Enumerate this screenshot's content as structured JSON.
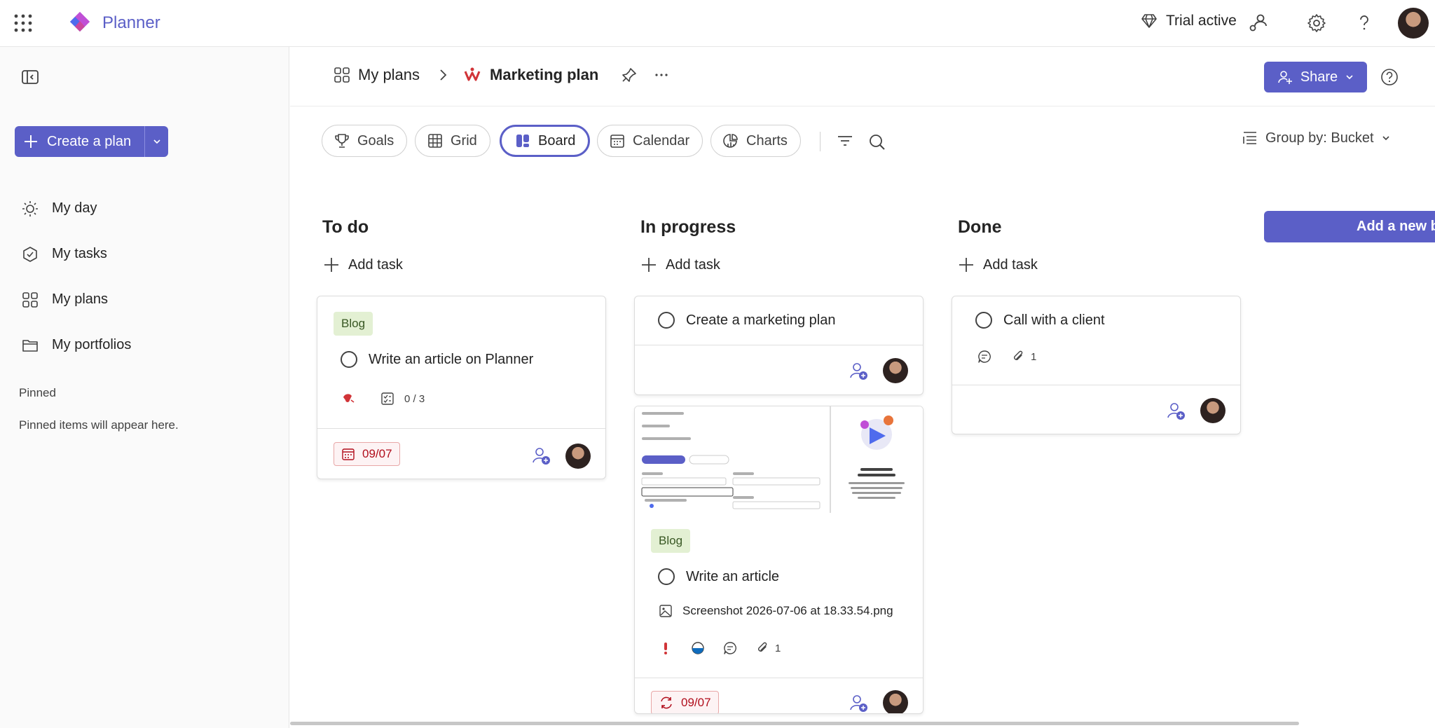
{
  "app": {
    "name": "Planner"
  },
  "topbar": {
    "trial_label": "Trial active"
  },
  "sidebar": {
    "create_label": "Create a plan",
    "items": [
      {
        "label": "My day",
        "icon": "sun-icon"
      },
      {
        "label": "My tasks",
        "icon": "tasks-icon"
      },
      {
        "label": "My plans",
        "icon": "grid-icon"
      },
      {
        "label": "My portfolios",
        "icon": "folder-icon"
      }
    ],
    "pinned_heading": "Pinned",
    "pinned_empty": "Pinned items will appear here."
  },
  "header": {
    "breadcrumb_root": "My plans",
    "plan_title": "Marketing plan",
    "share_label": "Share"
  },
  "views": {
    "tabs": [
      "Goals",
      "Grid",
      "Board",
      "Calendar",
      "Charts"
    ],
    "active": "Board",
    "group_by_label": "Group by: Bucket"
  },
  "board": {
    "add_task_label": "Add task",
    "add_bucket_label": "Add a new b",
    "buckets": [
      {
        "title": "To do",
        "cards": [
          {
            "label": "Blog",
            "title": "Write an article on Planner",
            "checklist": "0 / 3",
            "due": "09/07"
          }
        ]
      },
      {
        "title": "In progress",
        "cards": [
          {
            "title": "Create a marketing plan"
          },
          {
            "label": "Blog",
            "title": "Write an article",
            "attachment": "Screenshot 2026-07-06 at 18.33.54.png",
            "attachments_count": "1",
            "due": "09/07"
          }
        ]
      },
      {
        "title": "Done",
        "cards": [
          {
            "title": "Call with a client",
            "attachments_count": "1"
          }
        ]
      }
    ]
  },
  "colors": {
    "accent": "#5b5fc7",
    "label_bg": "#e3f0d3",
    "due_red": "#b10e1c"
  }
}
